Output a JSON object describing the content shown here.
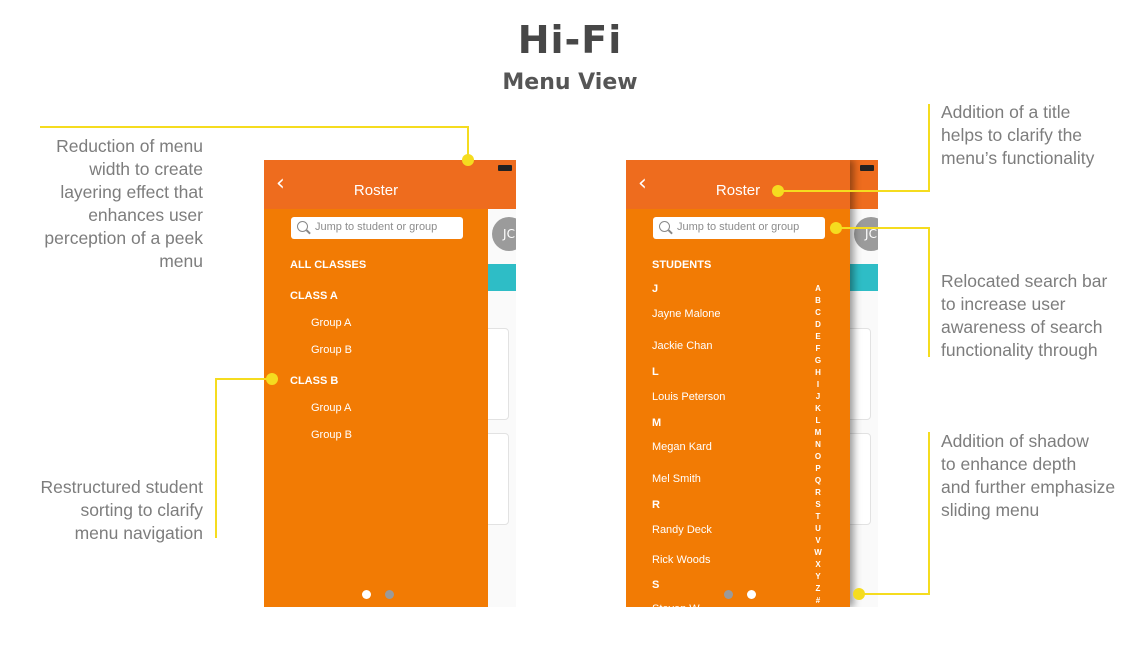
{
  "header": {
    "title": "Hi-Fi",
    "subtitle": "Menu View"
  },
  "annotations": {
    "menu_width": [
      "Reduction of menu",
      "width to create",
      "layering effect that",
      "enhances user",
      "perception of a peek",
      "menu"
    ],
    "sorting": [
      "Restructured student",
      "sorting to clarify",
      "menu navigation"
    ],
    "title": [
      "Addition of a title",
      "helps to clarify the",
      "menu’s functionality"
    ],
    "search": [
      "Relocated search bar",
      "to increase user",
      "awareness of search",
      "functionality through"
    ],
    "shadow": [
      "Addition of shadow",
      "to enhance depth",
      "and further emphasize",
      "sliding menu"
    ]
  },
  "phone_left": {
    "back_glyph": "‹",
    "title": "Roster",
    "search_placeholder": "Jump to student or group",
    "avatar_initials": "JC",
    "items": [
      {
        "label": "ALL CLASSES",
        "kind": "hdr"
      },
      {
        "label": "CLASS A",
        "kind": "hdr"
      },
      {
        "label": "Group A",
        "kind": "sub"
      },
      {
        "label": "Group B",
        "kind": "sub"
      },
      {
        "label": "CLASS B",
        "kind": "hdr"
      },
      {
        "label": "Group A",
        "kind": "sub"
      },
      {
        "label": "Group B",
        "kind": "sub"
      }
    ],
    "active_page": 0
  },
  "phone_right": {
    "back_glyph": "‹",
    "title": "Roster",
    "search_placeholder": "Jump to student or group",
    "avatar_initials": "JC",
    "section_label": "STUDENTS",
    "items": [
      {
        "label": "J",
        "kind": "hdr"
      },
      {
        "label": "Jayne Malone",
        "kind": "name"
      },
      {
        "label": "Jackie Chan",
        "kind": "name"
      },
      {
        "label": "L",
        "kind": "hdr"
      },
      {
        "label": "Louis Peterson",
        "kind": "name"
      },
      {
        "label": "M",
        "kind": "hdr"
      },
      {
        "label": "Megan Kard",
        "kind": "name"
      },
      {
        "label": "Mel Smith",
        "kind": "name"
      },
      {
        "label": "R",
        "kind": "hdr"
      },
      {
        "label": "Randy Deck",
        "kind": "name"
      },
      {
        "label": "Rick Woods",
        "kind": "name"
      },
      {
        "label": "S",
        "kind": "hdr"
      },
      {
        "label": "Steven W...",
        "kind": "name"
      }
    ],
    "alphabet": [
      "A",
      "B",
      "C",
      "D",
      "E",
      "F",
      "G",
      "H",
      "I",
      "J",
      "K",
      "L",
      "M",
      "N",
      "O",
      "P",
      "Q",
      "R",
      "S",
      "T",
      "U",
      "V",
      "W",
      "X",
      "Y",
      "Z",
      "#"
    ],
    "active_page": 1
  },
  "colors": {
    "accent": "#f5dc1f",
    "drawer": "#f27b04",
    "header": "#ee6c1e",
    "teal": "#2ebdc6"
  }
}
